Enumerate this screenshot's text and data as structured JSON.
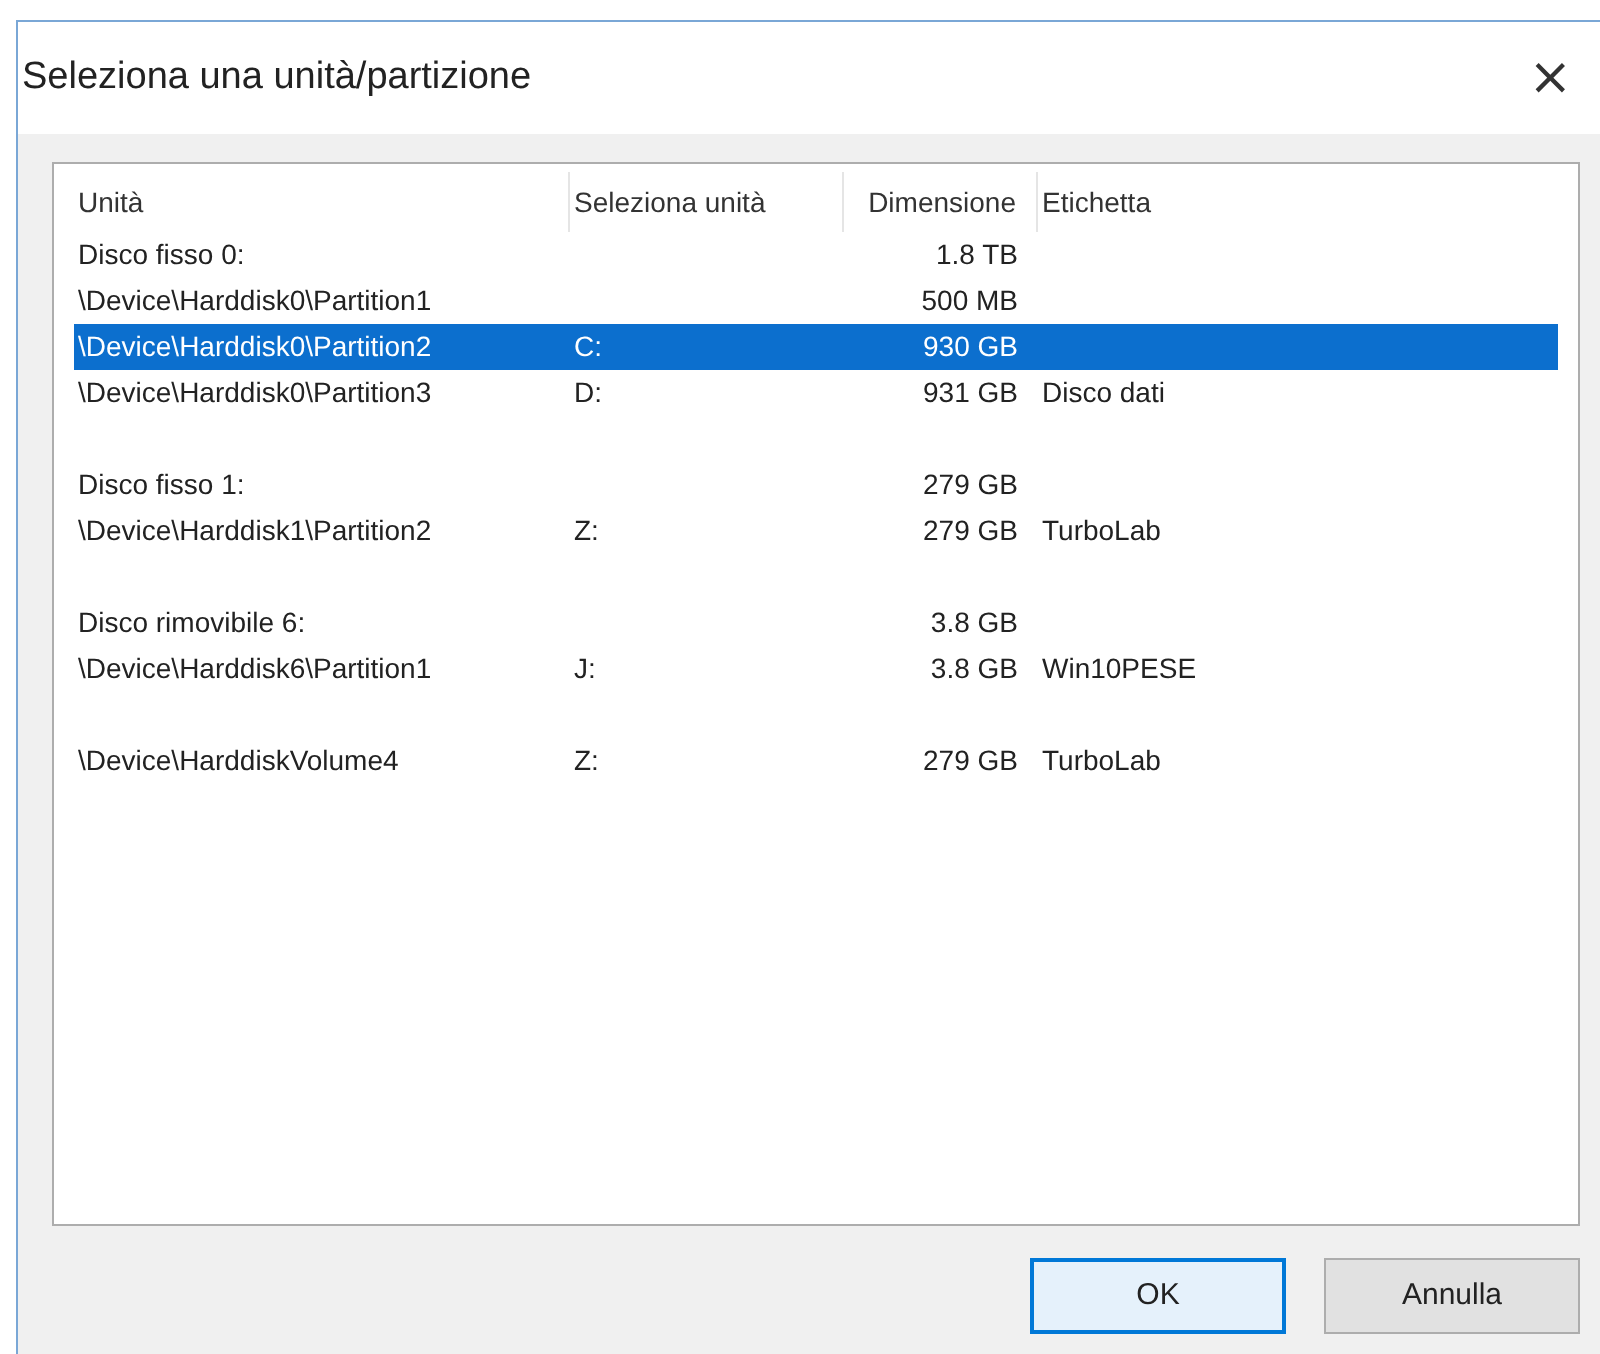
{
  "window": {
    "title": "Seleziona una unità/partizione",
    "close": "×"
  },
  "table": {
    "columns": [
      "Unità",
      "Seleziona unità",
      "Dimensione",
      "Etichetta"
    ],
    "groups": [
      {
        "rows": [
          {
            "unit": "Disco fisso 0:",
            "size": "1.8 TB",
            "selected": false
          },
          {
            "unit": "\\Device\\Harddisk0\\Partition1",
            "size": "500 MB",
            "selected": false
          },
          {
            "unit": "\\Device\\Harddisk0\\Partition2",
            "drive": "C:",
            "size": "930 GB",
            "selected": true
          },
          {
            "unit": "\\Device\\Harddisk0\\Partition3",
            "drive": "D:",
            "size": "931 GB",
            "label": "Disco dati",
            "selected": false
          }
        ]
      },
      {
        "rows": [
          {
            "unit": "Disco fisso 1:",
            "size": "279 GB",
            "selected": false
          },
          {
            "unit": "\\Device\\Harddisk1\\Partition2",
            "drive": "Z:",
            "size": "279 GB",
            "label": "TurboLab",
            "selected": false
          }
        ]
      },
      {
        "rows": [
          {
            "unit": "Disco rimovibile 6:",
            "size": "3.8 GB",
            "selected": false
          },
          {
            "unit": "\\Device\\Harddisk6\\Partition1",
            "drive": "J:",
            "size": "3.8 GB",
            "label": "Win10PESE",
            "selected": false
          }
        ]
      },
      {
        "rows": [
          {
            "unit": "\\Device\\HarddiskVolume4",
            "drive": "Z:",
            "size": "279 GB",
            "label": "TurboLab",
            "selected": false
          }
        ]
      }
    ]
  },
  "buttons": [
    {
      "label": "OK",
      "default": true
    },
    {
      "label": "Annulla",
      "default": false
    }
  ]
}
